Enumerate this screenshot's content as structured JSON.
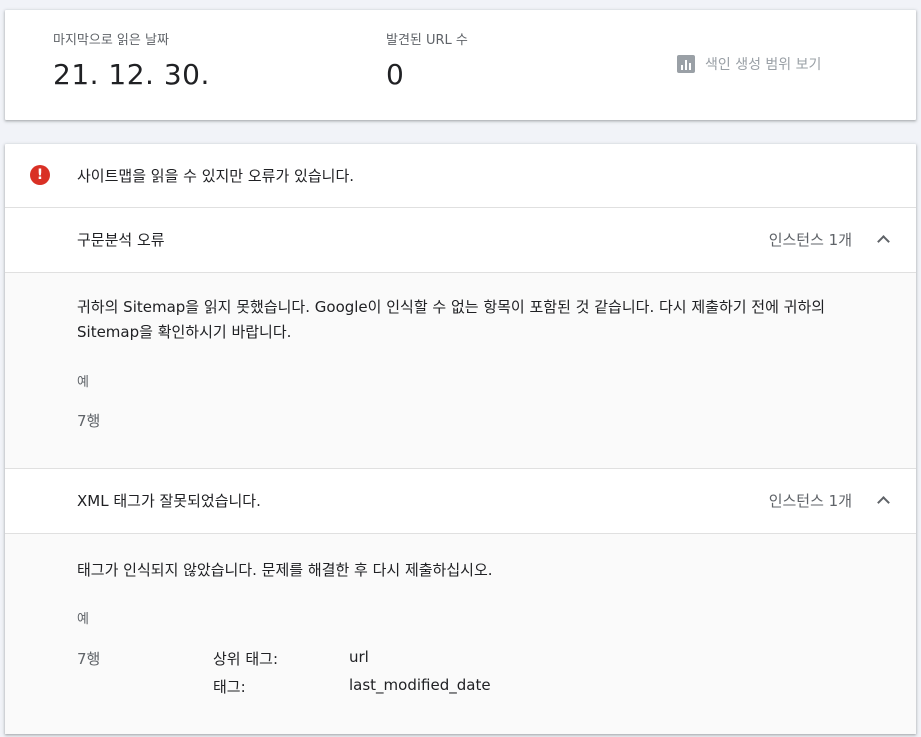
{
  "stats": {
    "last_read_label": "마지막으로 읽은 날짜",
    "last_read_value": "21. 12. 30.",
    "found_urls_label": "발견된 URL 수",
    "found_urls_value": "0",
    "coverage_link": "색인 생성 범위 보기",
    "coverage_icon": "bar-chart-icon"
  },
  "error": {
    "icon": "error-icon",
    "icon_glyph": "!",
    "title": "사이트맵을 읽을 수 있지만 오류가 있습니다."
  },
  "issues": [
    {
      "title": "구문분석 오류",
      "count": "인스턴스 1개",
      "description": "귀하의 Sitemap을 읽지 못했습니다. Google이 인식할 수 없는 항목이 포함된 것 같습니다. 다시 제출하기 전에 귀하의 Sitemap을 확인하시기 바랍니다.",
      "example_label": "예",
      "line": "7행"
    },
    {
      "title": "XML 태그가 잘못되었습니다.",
      "count": "인스턴스 1개",
      "description": "태그가 인식되지 않았습니다. 문제를 해결한 후 다시 제출하십시오.",
      "example_label": "예",
      "line": "7행",
      "details": [
        {
          "key": "상위 태그:",
          "value": "url"
        },
        {
          "key": "태그:",
          "value": "last_modified_date"
        }
      ]
    }
  ],
  "colors": {
    "error_red": "#d93025",
    "text_primary": "#202124",
    "text_secondary": "#5f6368",
    "page_bg": "#f1f3f8"
  }
}
